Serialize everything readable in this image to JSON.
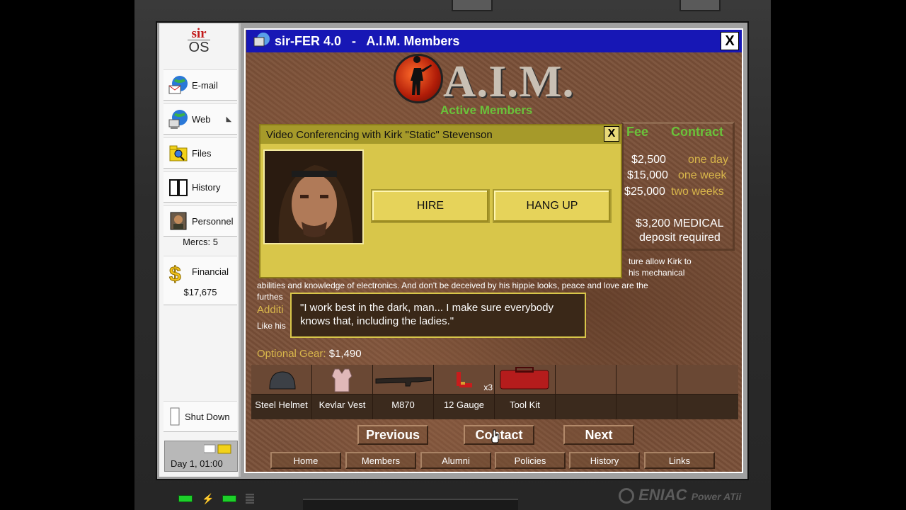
{
  "os": {
    "logo_top": "sir",
    "logo_bottom": "OS"
  },
  "sidebar": {
    "items": [
      {
        "label": "E-mail",
        "icon": "email-icon"
      },
      {
        "label": "Web",
        "icon": "web-icon"
      },
      {
        "label": "Files",
        "icon": "files-icon"
      },
      {
        "label": "History",
        "icon": "history-icon"
      },
      {
        "label": "Personnel",
        "icon": "personnel-icon",
        "sub": "Mercs: 5"
      },
      {
        "label": "Financial",
        "icon": "dollar-icon",
        "sub": "$17,675"
      }
    ],
    "shutdown": "Shut Down",
    "clock": "Day 1, 01:00"
  },
  "window": {
    "title": "sir-FER 4.0   -   A.I.M. Members",
    "close": "X"
  },
  "aim": {
    "logo": "A.I.M.",
    "subtitle": "Active Members"
  },
  "fees": {
    "fee_header": "Fee",
    "contract_header": "Contract",
    "rows": [
      {
        "amount": "$2,500",
        "duration": "one day"
      },
      {
        "amount": "$15,000",
        "duration": "one week"
      },
      {
        "amount": "$25,000",
        "duration": "two weeks"
      }
    ],
    "medical": "$3,200 MEDICAL",
    "medical_sub": "deposit required"
  },
  "dialog": {
    "title": "Video Conferencing with Kirk \"Static\" Stevenson",
    "close": "X",
    "hire": "HIRE",
    "hang_up": "HANG UP"
  },
  "bio": {
    "line1": "ture allow Kirk to",
    "line2": "his mechanical",
    "line3": "abilities and knowledge of electronics. And don't be deceived by his hippie looks, peace and love are the",
    "line4": "furthes",
    "additional": "Additi",
    "like": "Like his"
  },
  "quote": "\"I work best in the dark, man... I make sure everybody knows that, including the ladies.\"",
  "gear": {
    "label": "Optional Gear:",
    "price": "$1,490",
    "items": [
      {
        "name": "Steel Helmet",
        "count": ""
      },
      {
        "name": "Kevlar Vest",
        "count": ""
      },
      {
        "name": "M870",
        "count": ""
      },
      {
        "name": "12 Gauge",
        "count": "x3"
      },
      {
        "name": "Tool Kit",
        "count": ""
      },
      {
        "name": "",
        "count": ""
      },
      {
        "name": "",
        "count": ""
      },
      {
        "name": "",
        "count": ""
      }
    ]
  },
  "nav": {
    "previous": "Previous",
    "contact": "Contact",
    "next": "Next"
  },
  "links": [
    "Home",
    "Members",
    "Alumni",
    "Policies",
    "History",
    "Links"
  ],
  "bezel": {
    "brand": "ENIAC",
    "model": "Power ATii"
  },
  "colors": {
    "title_bar": "#1717b5",
    "dialog": "#d8c64a",
    "accent_green": "#6ac23a",
    "gold_text": "#d8b64a"
  }
}
